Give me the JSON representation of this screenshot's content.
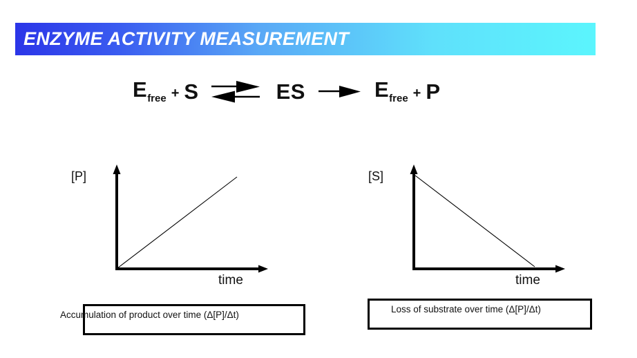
{
  "slide": {
    "title": "ENZYME ACTIVITY MEASUREMENT",
    "title_gradient_start": "#2b35e8",
    "title_gradient_end": "#5bf5fd",
    "title_text_color": "#ffffff",
    "background": "#ffffff"
  },
  "equation": {
    "term1_main": "E",
    "term1_sub": "free",
    "plus1": "+",
    "term2": "S",
    "arrow_reversible": "reversible-arrow-icon",
    "term3": "ES",
    "arrow_forward": "forward-arrow-icon",
    "term4_main": "E",
    "term4_sub": "free",
    "plus2": "+",
    "term5": "P"
  },
  "plots": [
    {
      "id": "product-plot",
      "y_label": "[P]",
      "x_label": "time",
      "trend": "increasing",
      "caption": "Accumulation of product over time (Δ[P]/Δt)"
    },
    {
      "id": "substrate-plot",
      "y_label": "[S]",
      "x_label": "time",
      "trend": "decreasing",
      "caption": "Loss of substrate over time (Δ[P]/Δt)"
    }
  ],
  "chart_data": [
    {
      "type": "line",
      "title": "Accumulation of product over time",
      "xlabel": "time",
      "ylabel": "[P]",
      "x": [
        0,
        1
      ],
      "values": [
        0,
        1
      ],
      "xlim": [
        0,
        1
      ],
      "ylim": [
        0,
        1
      ],
      "grid": false,
      "ticks": false,
      "legend": "none",
      "annotation": "Accumulation of product over time (Δ[P]/Δt)"
    },
    {
      "type": "line",
      "title": "Loss of substrate over time",
      "xlabel": "time",
      "ylabel": "[S]",
      "x": [
        0,
        1
      ],
      "values": [
        1,
        0
      ],
      "xlim": [
        0,
        1
      ],
      "ylim": [
        0,
        1
      ],
      "grid": false,
      "ticks": false,
      "legend": "none",
      "annotation": "Loss of substrate over time (Δ[P]/Δt)"
    }
  ]
}
